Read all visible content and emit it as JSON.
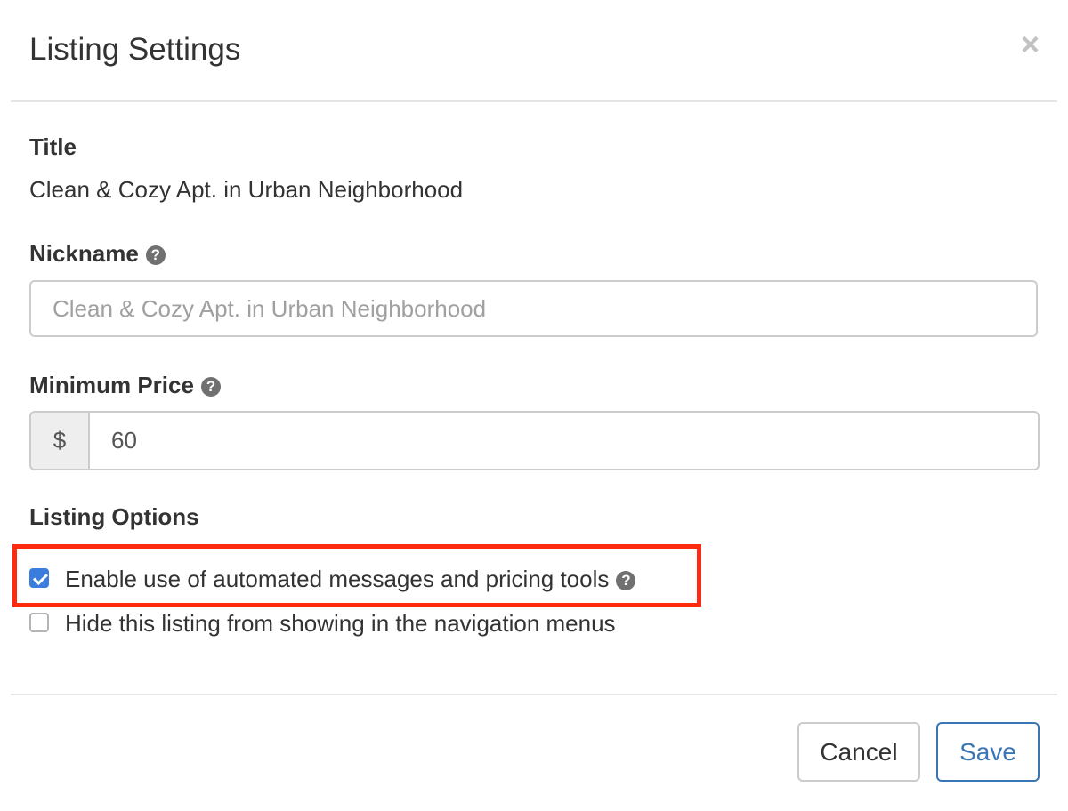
{
  "modal": {
    "title": "Listing Settings",
    "close_icon": "×"
  },
  "fields": {
    "title_label": "Title",
    "title_value": "Clean & Cozy Apt. in Urban Neighborhood",
    "nickname_label": "Nickname",
    "nickname_placeholder": "Clean & Cozy Apt. in Urban Neighborhood",
    "min_price_label": "Minimum Price",
    "currency_symbol": "$",
    "min_price_value": "60",
    "help_icon": "?"
  },
  "options": {
    "label": "Listing Options",
    "items": [
      {
        "label": "Enable use of automated messages and pricing tools",
        "checked": true,
        "highlighted": true
      },
      {
        "label": "Hide this listing from showing in the navigation menus",
        "checked": false,
        "highlighted": false
      }
    ]
  },
  "footer": {
    "cancel_label": "Cancel",
    "save_label": "Save"
  },
  "colors": {
    "accent": "#3b7ddd",
    "highlight": "#ff2a12",
    "save_border": "#3a76b5"
  }
}
